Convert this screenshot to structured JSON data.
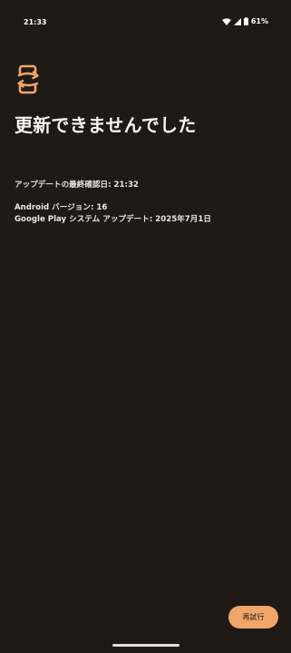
{
  "status_bar": {
    "time": "21:33",
    "battery_percent": "61%",
    "icons": [
      "wifi-icon",
      "cell-signal-icon",
      "battery-icon"
    ]
  },
  "content": {
    "icon": "phone-update-icon",
    "title": "更新できませんでした",
    "last_checked": "アップデートの最終確認日: 21:32",
    "android_version": "Android バージョン: 16",
    "google_play_update": "Google Play システム アップデート: 2025年7月1日"
  },
  "actions": {
    "retry_label": "再試行"
  },
  "colors": {
    "background": "#201a17",
    "accent": "#f0a66b",
    "text": "#f3ece8"
  }
}
